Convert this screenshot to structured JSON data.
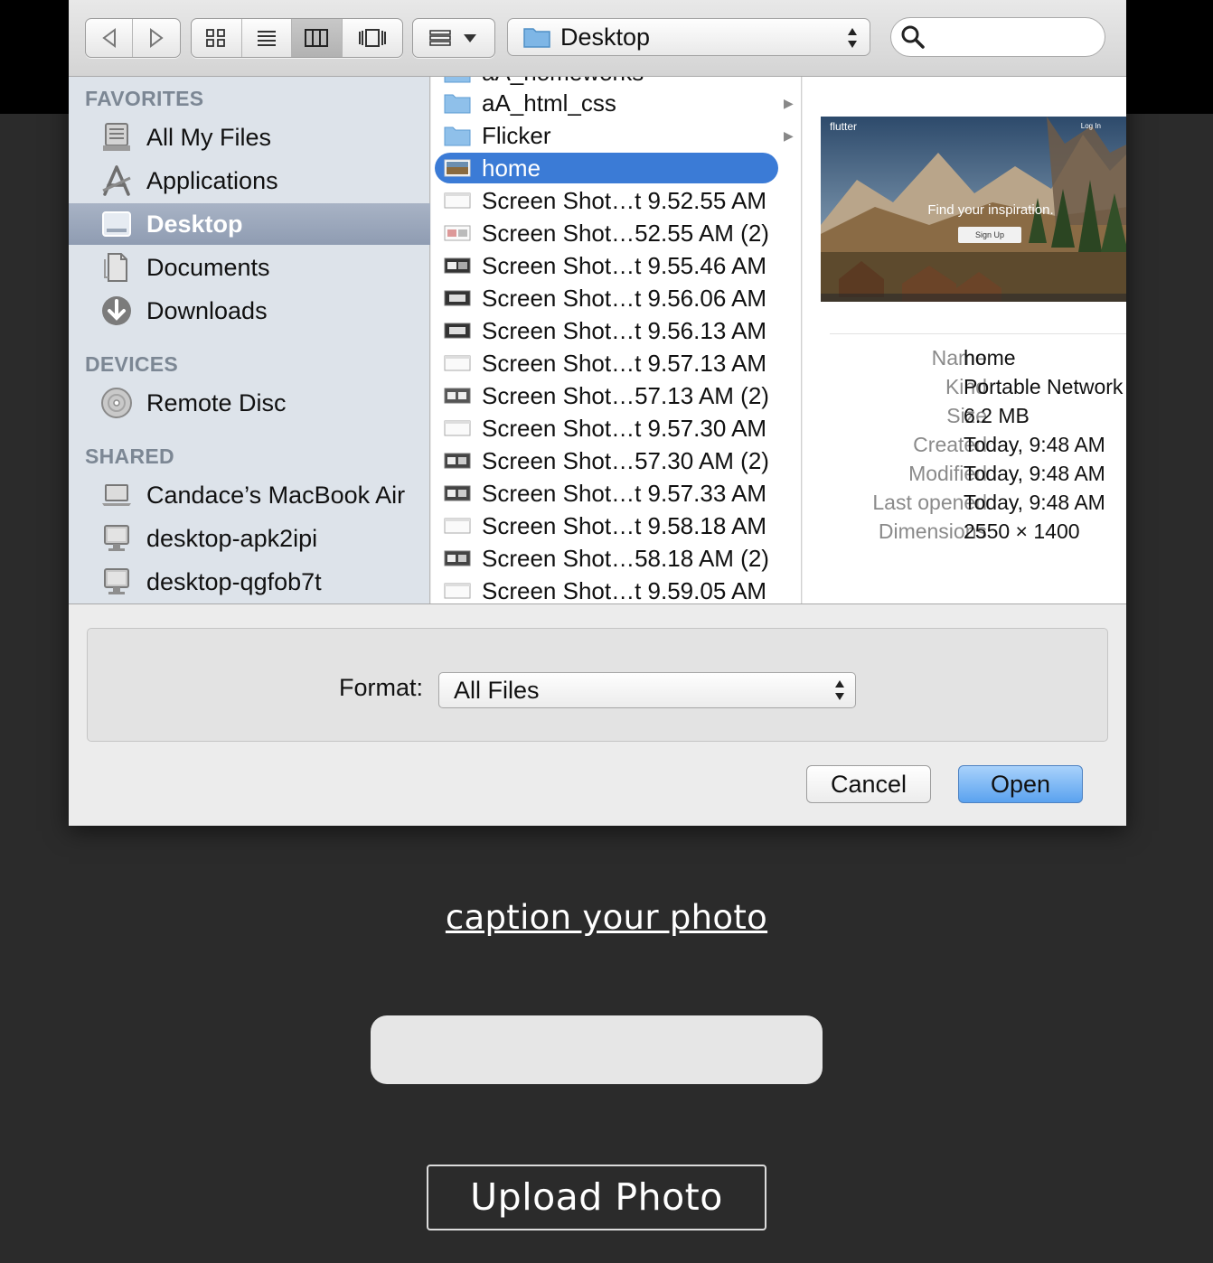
{
  "dialog": {
    "toolbar": {
      "location": "Desktop",
      "search_placeholder": ""
    },
    "sidebar": {
      "favorites_header": "FAVORITES",
      "devices_header": "DEVICES",
      "shared_header": "SHARED",
      "favorites": [
        {
          "label": "All My Files",
          "icon": "all-files-icon"
        },
        {
          "label": "Applications",
          "icon": "applications-icon"
        },
        {
          "label": "Desktop",
          "icon": "desktop-folder-icon",
          "selected": true
        },
        {
          "label": "Documents",
          "icon": "documents-icon"
        },
        {
          "label": "Downloads",
          "icon": "downloads-icon"
        }
      ],
      "devices": [
        {
          "label": "Remote Disc",
          "icon": "disc-icon"
        }
      ],
      "shared": [
        {
          "label": "Candace’s MacBook Air",
          "icon": "laptop-icon"
        },
        {
          "label": "desktop-apk2ipi",
          "icon": "pc-icon"
        },
        {
          "label": "desktop-qgfob7t",
          "icon": "pc-icon"
        }
      ]
    },
    "files": [
      {
        "name": "aA_homeworks",
        "type": "folder",
        "partial": true
      },
      {
        "name": "aA_html_css",
        "type": "folder",
        "arrow": true
      },
      {
        "name": "Flicker",
        "type": "folder",
        "arrow": true
      },
      {
        "name": "home",
        "type": "image",
        "selected": true
      },
      {
        "name": "Screen Shot…t 9.52.55 AM",
        "type": "shot"
      },
      {
        "name": "Screen Shot…52.55 AM (2)",
        "type": "shot"
      },
      {
        "name": "Screen Shot…t 9.55.46 AM",
        "type": "shot"
      },
      {
        "name": "Screen Shot…t 9.56.06 AM",
        "type": "shot"
      },
      {
        "name": "Screen Shot…t 9.56.13 AM",
        "type": "shot"
      },
      {
        "name": "Screen Shot…t 9.57.13 AM",
        "type": "shot"
      },
      {
        "name": "Screen Shot…57.13 AM (2)",
        "type": "shot"
      },
      {
        "name": "Screen Shot…t 9.57.30 AM",
        "type": "shot"
      },
      {
        "name": "Screen Shot…57.30 AM (2)",
        "type": "shot"
      },
      {
        "name": "Screen Shot…t 9.57.33 AM",
        "type": "shot"
      },
      {
        "name": "Screen Shot…t 9.58.18 AM",
        "type": "shot"
      },
      {
        "name": "Screen Shot…58.18 AM (2)",
        "type": "shot"
      },
      {
        "name": "Screen Shot…t 9.59.05 AM",
        "type": "shot"
      }
    ],
    "preview": {
      "thumbnail": {
        "brand": "flutter",
        "tagline": "Find your inspiration.",
        "signup": "Sign Up",
        "login": "Log In"
      },
      "info": [
        {
          "key": "Name",
          "value": "home"
        },
        {
          "key": "Kind",
          "value": "Portable Network Graphics image"
        },
        {
          "key": "Size",
          "value": "6.2 MB"
        },
        {
          "key": "Created",
          "value": "Today, 9:48 AM"
        },
        {
          "key": "Modified",
          "value": "Today, 9:48 AM"
        },
        {
          "key": "Last opened",
          "value": "Today, 9:48 AM"
        },
        {
          "key": "Dimensions",
          "value": "2550 × 1400"
        }
      ]
    },
    "format": {
      "label": "Format:",
      "value": "All Files"
    },
    "buttons": {
      "cancel": "Cancel",
      "open": "Open"
    }
  },
  "page": {
    "caption_label": "caption your photo",
    "caption_value": "",
    "upload_button": "Upload Photo"
  },
  "colors": {
    "page_bg": "#2b2b2b",
    "selection": "#3b7bd6",
    "sidebar_bg": "#dde3ea"
  }
}
